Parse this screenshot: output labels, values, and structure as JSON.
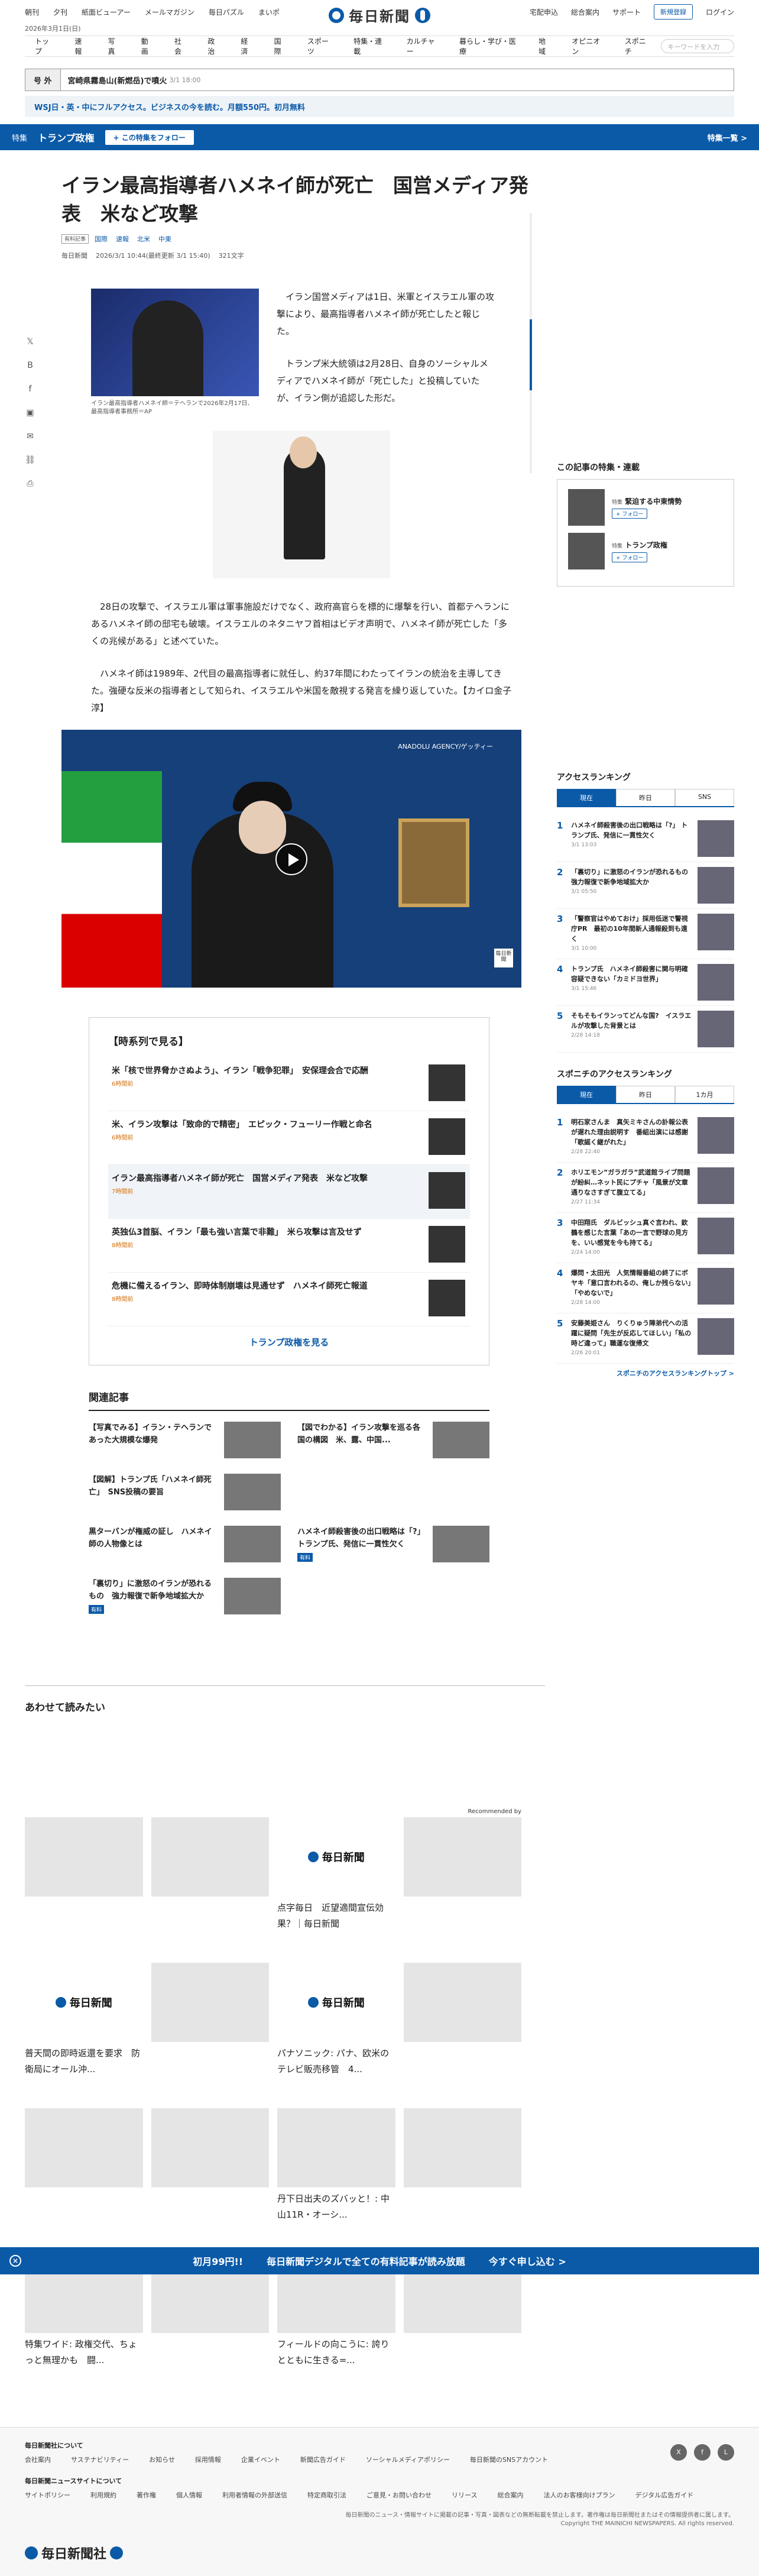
{
  "top": {
    "links": [
      "朝刊",
      "夕刊",
      "紙面ビューアー",
      "メールマガジン",
      "毎日パズル",
      "まいポ"
    ],
    "logo": "毎日新聞",
    "right_links": [
      "宅配申込",
      "総合案内",
      "サポート"
    ],
    "register": "新規登録",
    "login": "ログイン",
    "date": "2026年3月1日(日)"
  },
  "nav": {
    "items": [
      "トップ",
      "速報",
      "写真",
      "動画",
      "社会",
      "政治",
      "経済",
      "国際",
      "スポーツ",
      "特集・連載",
      "カルチャー",
      "暮らし・学び・医療",
      "地域",
      "オピニオン",
      "スポニチ"
    ],
    "search_placeholder": "キーワードを入力"
  },
  "breaking": {
    "tag": "号 外",
    "text": "宮崎県霧島山(新燃岳)で噴火",
    "time": "3/1 18:00"
  },
  "promo": "WSJ日・英・中にフルアクセス。ビジネスの今を読む。月額550円。初月無料",
  "feature": {
    "label": "特集",
    "title": "トランプ政権",
    "follow": "+ この特集をフォロー",
    "all": "特集一覧 >"
  },
  "article": {
    "title": "イラン最高指導者ハメネイ師が死亡　国営メディア発表　米など攻撃",
    "premium": "有料記事",
    "tags": [
      "国際",
      "速報",
      "北米",
      "中東"
    ],
    "source": "毎日新聞",
    "time": "2026/3/1 10:44(最終更新 3/1 15:40)",
    "chars": "321文字",
    "caption": "イラン最高指導者ハメネイ師＝テヘランで2026年2月17日、最高指導者事務所＝AP",
    "p1": "　イラン国営メディアは1日、米軍とイスラエル軍の攻撃により、最高指導者ハメネイ師が死亡したと報じた。",
    "p2": "　トランプ米大統領は2月28日、自身のソーシャルメディアでハメネイ師が「死亡した」と投稿していたが、イラン側が追認した形だ。",
    "p3": "　28日の攻撃で、イスラエル軍は軍事施設だけでなく、政府高官らを標的に爆撃を行い、首都テヘランにあるハメネイ師の邸宅も破壊。イスラエルのネタニヤフ首相はビデオ声明で、ハメネイ師が死亡した「多くの兆候がある」と述べていた。",
    "p4": "　ハメネイ師は1989年、2代目の最高指導者に就任し、約37年間にわたってイランの統治を主導してきた。強硬な反米の指導者として知られ、イスラエルや米国を敵視する発言を繰り返していた。【カイロ金子淳】",
    "video_credit": "ANADOLU AGENCY/ゲッティー",
    "video_badge": "毎日新聞"
  },
  "timeline": {
    "title": "【時系列で見る】",
    "items": [
      {
        "t": "米「核で世界脅かさぬよう」、イラン「戦争犯罪」　安保理会合で応酬",
        "tm": "6時間前"
      },
      {
        "t": "米、イラン攻撃は「致命的で精密」　エピック・フューリー作戦と命名",
        "tm": "6時間前"
      },
      {
        "t": "イラン最高指導者ハメネイ師が死亡　国営メディア発表　米など攻撃",
        "tm": "7時間前"
      },
      {
        "t": "英独仏3首脳、イラン「最も強い言葉で非難」　米ら攻撃は言及せず",
        "tm": "8時間前"
      },
      {
        "t": "危機に備えるイラン、即時体制崩壊は見通せず　ハメネイ師死亡報道",
        "tm": "8時間前"
      }
    ],
    "more": "トランプ政権を見る"
  },
  "related": {
    "title": "関連記事",
    "items": [
      {
        "t": "【写真でみる】イラン・テヘランであった大規模な爆発"
      },
      {
        "t": "【図でわかる】イラン攻撃を巡る各国の構図　米、露、中国..."
      },
      {
        "t": "【図解】トランプ氏「ハメネイ師死亡」　SNS投稿の要旨"
      },
      {
        "t": ""
      },
      {
        "t": "黒ターバンが権威の証し　ハメネイ師の人物像とは"
      },
      {
        "t": "ハメネイ師殺害後の出口戦略は「?」　トランプ氏、発信に一貫性欠く",
        "pm": "有料"
      },
      {
        "t": "「裏切り」に激怒のイランが恐れるもの　強力報復で新争地域拡大か",
        "pm": "有料"
      }
    ]
  },
  "also": {
    "title": "あわせて読みたい",
    "recommended": "Recommended by",
    "items": [
      "",
      "",
      "点字毎日　近望適間宣伝効果？｜毎日新聞",
      "",
      "普天間の即時返還を要求　防衛局にオール沖...",
      "",
      "パナソニック: パナ、欧米のテレビ販売移管　4...",
      "",
      "",
      "",
      "丹下日出夫のズバッと！: 中山11R・オーシ...",
      "",
      "特集ワイド: 政権交代、ちょっと無理かも　闘...",
      "",
      "フィールドの向こうに: 誇りとともに生きる=...",
      ""
    ]
  },
  "banner": {
    "price": "初月99円!!",
    "text": "毎日新聞デジタルで全ての有料記事が読み放題",
    "cta": "今すぐ申し込む >"
  },
  "side": {
    "feature_title": "この記事の特集・連載",
    "features": [
      {
        "label": "特集",
        "name": "緊迫する中東情勢",
        "follow": "+ フォロー"
      },
      {
        "label": "特集",
        "name": "トランプ政権",
        "follow": "+ フォロー"
      }
    ],
    "rank_title": "アクセスランキング",
    "rank_tabs": [
      "現在",
      "昨日",
      "SNS"
    ],
    "ranks": [
      {
        "t": "ハメネイ師殺害後の出口戦略は「?」 トランプ氏、発信に一貫性欠く",
        "tm": "3/1 13:03"
      },
      {
        "t": "「裏切り」に激怒のイランが恐れるもの　強力報復で新争地域拡大か",
        "tm": "3/1 05:50"
      },
      {
        "t": "「警察官はやめておけ」採用低迷で警視庁PR　最初の10年間新人通報殺到も遠く",
        "tm": "3/1 10:00"
      },
      {
        "t": "トランプ氏　ハメネイ師殺害に関与明確　容疑できない「カミドヨ世界」",
        "tm": "3/1 15:46"
      },
      {
        "t": "そもそもイランってどんな国?　イスラエルが攻撃した背景とは",
        "tm": "2/28 14:18"
      }
    ],
    "spo_title": "スポニチのアクセスランキング",
    "spo_tabs": [
      "現在",
      "昨日",
      "1カ月"
    ],
    "spos": [
      {
        "t": "明石家さんま　真矢ミキさんの訃報公表が遅れた理由説明す　番組出演には感謝「歌謡く継がれた」",
        "tm": "2/28 22:40"
      },
      {
        "t": "ホリエモン”ガラガラ”武道館ライブ問題が紛糾…ネット民にプチャ「風景が文章通りなさすぎて腹立てる」",
        "tm": "2/27 11:34"
      },
      {
        "t": "中田翔氏　ダルビッシュ真ぐ言われ、欽鶴を感じた言葉「あの一言で野球の見方を、いい感覚を今も持てる」",
        "tm": "2/24 14:00"
      },
      {
        "t": "爆問・太田光　人気情報番組の終了にボヤキ「意口言われるの、俺しか残らない」「やめないで」",
        "tm": "2/28 14:00"
      },
      {
        "t": "安藤美姫さん　りくりゅう陣弟代への活躍に疑問「先生が反応してほしい」「私の時ど違って」職運な復帰文",
        "tm": "2/26 20:01"
      }
    ],
    "spo_more": "スポニチのアクセスランキングトップ >"
  },
  "footer": {
    "about": "毎日新聞社について",
    "links1": [
      "会社案内",
      "サステナビリティー",
      "お知らせ",
      "採用情報",
      "企業イベント",
      "新聞広告ガイド",
      "ソーシャルメディアポリシー",
      "毎日新聞のSNSアカウント"
    ],
    "news": "毎日新聞ニュースサイトについて",
    "links2": [
      "サイトポリシー",
      "利用規約",
      "著作権",
      "個人情報",
      "利用者情報の外部送信",
      "特定商取引法",
      "ご意見・お問い合わせ",
      "リリース",
      "総合案内",
      "法人のお客様向けプラン",
      "デジタル広告ガイド"
    ],
    "copy": "毎日新聞のニュース・情報サイトに掲載の記事・写真・図表などの無断転載を禁止します。著作権は毎日新聞社またはその情報提供者に属します。",
    "copy2": "Copyright THE MAINICHI NEWSPAPERS. All rights reserved.",
    "logo": "毎日新聞社"
  }
}
